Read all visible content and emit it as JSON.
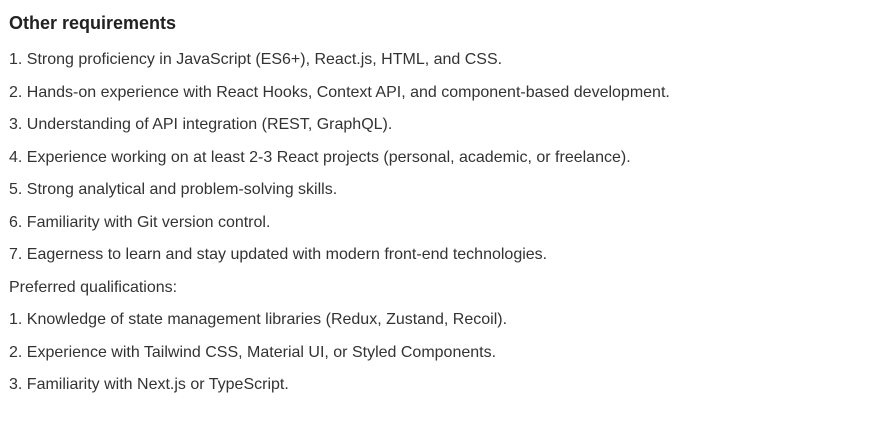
{
  "section": {
    "title": "Other requirements",
    "lines": [
      "1. Strong proficiency in JavaScript (ES6+), React.js, HTML, and CSS.",
      "2. Hands-on experience with React Hooks, Context API, and component-based development.",
      "3. Understanding of API integration (REST, GraphQL).",
      "4. Experience working on at least 2-3 React projects (personal, academic, or freelance).",
      "5. Strong analytical and problem-solving skills.",
      "6. Familiarity with Git version control.",
      "7. Eagerness to learn and stay updated with modern front-end technologies.",
      "Preferred qualifications:",
      "1. Knowledge of state management libraries (Redux, Zustand, Recoil).",
      "2. Experience with Tailwind CSS, Material UI, or Styled Components.",
      "3. Familiarity with Next.js or TypeScript."
    ]
  }
}
